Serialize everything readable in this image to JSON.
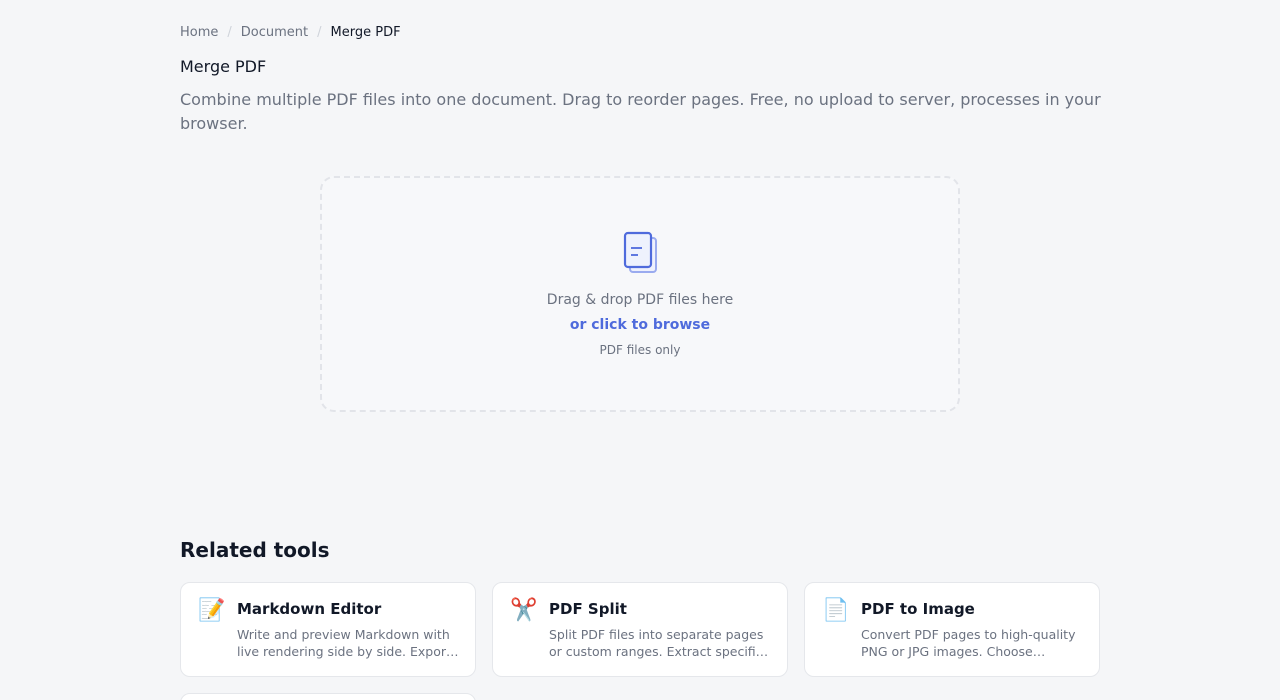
{
  "breadcrumb": {
    "items": [
      "Home",
      "Document"
    ],
    "separator": "/",
    "current": "Merge PDF"
  },
  "page": {
    "title": "Merge PDF",
    "description": "Combine multiple PDF files into one document. Drag to reorder pages. Free, no upload to server, processes in your browser."
  },
  "dropzone": {
    "icon": "document-stack-icon",
    "primary_text": "Drag & drop PDF files here",
    "browse_text": "or click to browse",
    "hint_text": "PDF files only"
  },
  "related": {
    "title": "Related tools",
    "cards": [
      {
        "icon": "memo-icon",
        "glyph": "📝",
        "title": "Markdown Editor",
        "description": "Write and preview Markdown with live rendering side by side. Export to HTML or copy the formatted output instantly."
      },
      {
        "icon": "scissors-icon",
        "glyph": "✂️",
        "title": "PDF Split",
        "description": "Split PDF files into separate pages or custom ranges. Extract specific pages into new documents."
      },
      {
        "icon": "page-icon",
        "glyph": "📄",
        "title": "PDF to Image",
        "description": "Convert PDF pages to high-quality PNG or JPG images. Choose resolution and export format."
      }
    ]
  },
  "colors": {
    "accent": "#4f6bdc",
    "background": "#f5f6f8",
    "border": "#e5e7eb",
    "muted_text": "#6b7280"
  }
}
